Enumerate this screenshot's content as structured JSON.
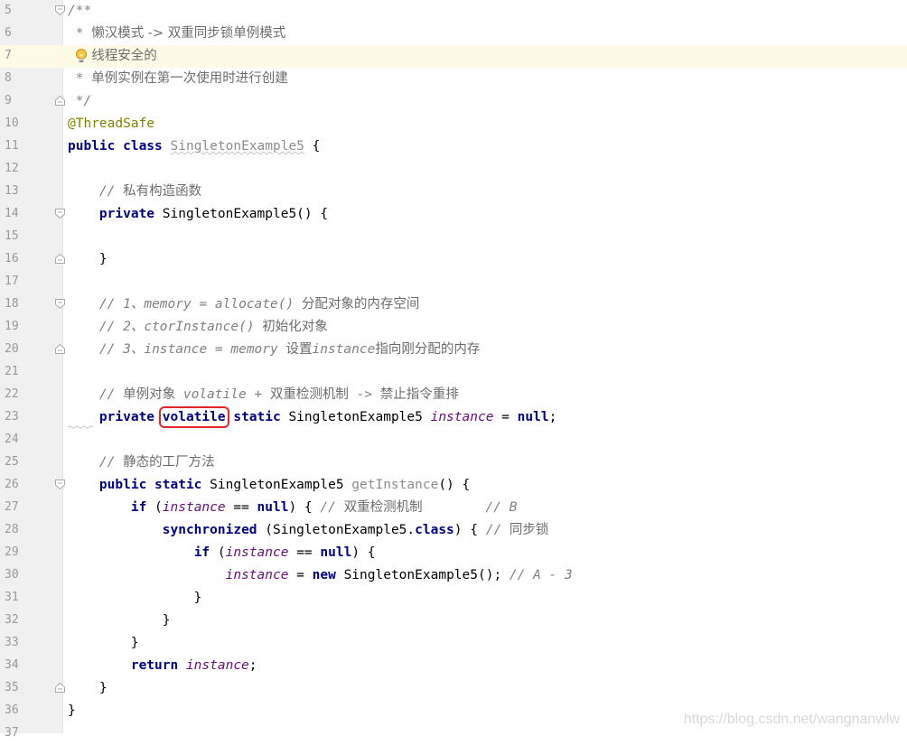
{
  "editor": {
    "lines": [
      {
        "n": "5",
        "fold": "open",
        "tokens": [
          {
            "t": "/**",
            "c": "cmt"
          }
        ]
      },
      {
        "n": "6",
        "tokens": [
          {
            "t": " * ",
            "c": "cmt"
          },
          {
            "t": "懒汉模式 -> 双重同步锁单例模式",
            "c": "cjk"
          }
        ]
      },
      {
        "n": "7",
        "current": true,
        "bulb": true,
        "tokens": [
          {
            "t": "   ",
            "c": "cmt"
          },
          {
            "t": "线程安全的",
            "c": "cjk"
          }
        ]
      },
      {
        "n": "8",
        "tokens": [
          {
            "t": " * ",
            "c": "cmt"
          },
          {
            "t": "单例实例在第一次使用时进行创建",
            "c": "cjk"
          }
        ]
      },
      {
        "n": "9",
        "fold": "close",
        "tokens": [
          {
            "t": " */",
            "c": "cmt"
          }
        ]
      },
      {
        "n": "10",
        "tokens": [
          {
            "t": "@ThreadSafe",
            "c": "ann"
          }
        ]
      },
      {
        "n": "11",
        "tokens": [
          {
            "t": "public class ",
            "c": "kw"
          },
          {
            "t": "SingletonExample5",
            "c": "unused",
            "wave": true
          },
          {
            "t": " {",
            "c": "plain"
          }
        ]
      },
      {
        "n": "12",
        "tokens": []
      },
      {
        "n": "13",
        "tokens": [
          {
            "t": "    // ",
            "c": "cmt"
          },
          {
            "t": "私有构造函数",
            "c": "cjk"
          }
        ]
      },
      {
        "n": "14",
        "fold": "open",
        "tokens": [
          {
            "t": "    ",
            "c": "plain"
          },
          {
            "t": "private ",
            "c": "kw"
          },
          {
            "t": "SingletonExample5() {",
            "c": "plain"
          }
        ]
      },
      {
        "n": "15",
        "tokens": []
      },
      {
        "n": "16",
        "fold": "close",
        "tokens": [
          {
            "t": "    }",
            "c": "plain"
          }
        ]
      },
      {
        "n": "17",
        "tokens": []
      },
      {
        "n": "18",
        "fold": "open",
        "tokens": [
          {
            "t": "    // 1、memory = allocate() ",
            "c": "cmt"
          },
          {
            "t": "分配对象的内存空间",
            "c": "cjk"
          }
        ]
      },
      {
        "n": "19",
        "tokens": [
          {
            "t": "    // 2、ctorInstance() ",
            "c": "cmt"
          },
          {
            "t": "初始化对象",
            "c": "cjk"
          }
        ]
      },
      {
        "n": "20",
        "fold": "close",
        "tokens": [
          {
            "t": "    // 3、instance = memory ",
            "c": "cmt"
          },
          {
            "t": "设置",
            "c": "cjk"
          },
          {
            "t": "instance",
            "c": "cmt"
          },
          {
            "t": "指向刚分配的内存",
            "c": "cjk"
          }
        ]
      },
      {
        "n": "21",
        "tokens": []
      },
      {
        "n": "22",
        "tokens": [
          {
            "t": "    // ",
            "c": "cmt"
          },
          {
            "t": "单例对象",
            "c": "cjk"
          },
          {
            "t": " volatile + ",
            "c": "cmt"
          },
          {
            "t": "双重检测机制",
            "c": "cjk"
          },
          {
            "t": " -> ",
            "c": "cmt"
          },
          {
            "t": "禁止指令重排",
            "c": "cjk"
          }
        ]
      },
      {
        "n": "23",
        "tokens": [
          {
            "t": "    ",
            "c": "plain"
          },
          {
            "t": "private ",
            "c": "kw"
          },
          {
            "t": "volatile",
            "c": "kw",
            "box": true
          },
          {
            "t": " static ",
            "c": "kw"
          },
          {
            "t": "SingletonExample5 ",
            "c": "plain"
          },
          {
            "t": "instance",
            "c": "field"
          },
          {
            "t": " = ",
            "c": "plain"
          },
          {
            "t": "null",
            "c": "kw"
          },
          {
            "t": ";",
            "c": "plain"
          }
        ]
      },
      {
        "n": "24",
        "tokens": []
      },
      {
        "n": "25",
        "tokens": [
          {
            "t": "    // ",
            "c": "cmt"
          },
          {
            "t": "静态的工厂方法",
            "c": "cjk"
          }
        ]
      },
      {
        "n": "26",
        "fold": "open",
        "tokens": [
          {
            "t": "    ",
            "c": "plain"
          },
          {
            "t": "public static ",
            "c": "kw"
          },
          {
            "t": "SingletonExample5 ",
            "c": "plain"
          },
          {
            "t": "getInstance",
            "c": "unused"
          },
          {
            "t": "() {",
            "c": "plain"
          }
        ]
      },
      {
        "n": "27",
        "tokens": [
          {
            "t": "        ",
            "c": "plain"
          },
          {
            "t": "if ",
            "c": "kw"
          },
          {
            "t": "(",
            "c": "plain"
          },
          {
            "t": "instance",
            "c": "field"
          },
          {
            "t": " == ",
            "c": "plain"
          },
          {
            "t": "null",
            "c": "kw"
          },
          {
            "t": ") { ",
            "c": "plain"
          },
          {
            "t": "// ",
            "c": "cmt"
          },
          {
            "t": "双重检测机制",
            "c": "cjk"
          },
          {
            "t": "        // B",
            "c": "cmt"
          }
        ]
      },
      {
        "n": "28",
        "tokens": [
          {
            "t": "            ",
            "c": "plain"
          },
          {
            "t": "synchronized ",
            "c": "kw"
          },
          {
            "t": "(SingletonExample5.",
            "c": "plain"
          },
          {
            "t": "class",
            "c": "kw"
          },
          {
            "t": ") { ",
            "c": "plain"
          },
          {
            "t": "// ",
            "c": "cmt"
          },
          {
            "t": "同步锁",
            "c": "cjk"
          }
        ]
      },
      {
        "n": "29",
        "tokens": [
          {
            "t": "                ",
            "c": "plain"
          },
          {
            "t": "if ",
            "c": "kw"
          },
          {
            "t": "(",
            "c": "plain"
          },
          {
            "t": "instance",
            "c": "field"
          },
          {
            "t": " == ",
            "c": "plain"
          },
          {
            "t": "null",
            "c": "kw"
          },
          {
            "t": ") {",
            "c": "plain"
          }
        ]
      },
      {
        "n": "30",
        "tokens": [
          {
            "t": "                    ",
            "c": "plain"
          },
          {
            "t": "instance",
            "c": "field"
          },
          {
            "t": " = ",
            "c": "plain"
          },
          {
            "t": "new ",
            "c": "kw"
          },
          {
            "t": "SingletonExample5(); ",
            "c": "plain"
          },
          {
            "t": "// A - 3",
            "c": "cmt"
          }
        ]
      },
      {
        "n": "31",
        "tokens": [
          {
            "t": "                }",
            "c": "plain"
          }
        ]
      },
      {
        "n": "32",
        "tokens": [
          {
            "t": "            }",
            "c": "plain"
          }
        ]
      },
      {
        "n": "33",
        "tokens": [
          {
            "t": "        }",
            "c": "plain"
          }
        ]
      },
      {
        "n": "34",
        "tokens": [
          {
            "t": "        ",
            "c": "plain"
          },
          {
            "t": "return ",
            "c": "kw"
          },
          {
            "t": "instance",
            "c": "field"
          },
          {
            "t": ";",
            "c": "plain"
          }
        ]
      },
      {
        "n": "35",
        "fold": "close",
        "tokens": [
          {
            "t": "    }",
            "c": "plain"
          }
        ]
      },
      {
        "n": "36",
        "tokens": [
          {
            "t": "}",
            "c": "plain"
          }
        ]
      },
      {
        "n": "37",
        "tokens": []
      }
    ]
  },
  "watermark": "https://blog.csdn.net/wangnanwlw",
  "colors": {
    "keyword": "#000080",
    "comment": "#808080",
    "annotation": "#808000",
    "field": "#660e7a",
    "unused": "#8c8c8c",
    "current_line": "#fdfbe5",
    "highlight_box": "#e4262b"
  },
  "icons": {
    "bulb": "lightbulb-icon",
    "fold_open": "fold-open-icon",
    "fold_close": "fold-close-icon"
  }
}
